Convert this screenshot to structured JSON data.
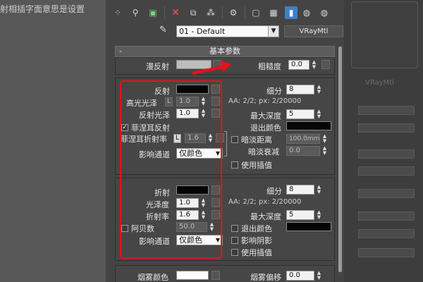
{
  "background": {
    "left_text": "射相插字面意思是设置",
    "right_label": "VRayMtl"
  },
  "toolbar": {
    "icons": [
      "sphere-dots-icon",
      "teapot-icon",
      "green-cube-icon",
      "delete-x-icon",
      "copy-icon",
      "cubes-icon",
      "gears-icon",
      "square-icon",
      "checker-icon",
      "active-slot-icon",
      "globe-icon",
      "globe-2-icon"
    ]
  },
  "material": {
    "name": "01 - Default",
    "type": "VRayMtl"
  },
  "rollout": {
    "title": "基本参数",
    "minus": "-"
  },
  "diffuse": {
    "label": "漫反射",
    "roughness_label": "粗糙度",
    "roughness_value": "0.0"
  },
  "reflection": {
    "reflect_label": "反射",
    "hilight_label": "高光光泽",
    "hilight_lock": "L",
    "hilight_value": "1.0",
    "gloss_label": "反射光泽",
    "gloss_value": "1.0",
    "fresnel_label": "菲涅耳反射",
    "fresnel_ior_label": "菲涅耳折射率",
    "fresnel_ior_lock": "L",
    "fresnel_ior_value": "1.6",
    "affect_label": "影响通道",
    "affect_value": "仅颜色",
    "subdivs_label": "细分",
    "subdivs_value": "8",
    "aa_text": "AA: 2/2; px: 2/20000",
    "max_depth_label": "最大深度",
    "max_depth_value": "5",
    "exit_color_label": "退出颜色",
    "dim_dist_label": "暗淡距离",
    "dim_dist_value": "100.0mm",
    "dim_falloff_label": "暗淡衰减",
    "dim_falloff_value": "0.0",
    "interp_label": "使用插值"
  },
  "refraction": {
    "refract_label": "折射",
    "gloss_label": "光泽度",
    "gloss_value": "1.0",
    "ior_label": "折射率",
    "ior_value": "1.6",
    "abbe_label": "阿贝数",
    "abbe_value": "50.0",
    "affect_label": "影响通道",
    "affect_value": "仅颜色",
    "subdivs_label": "细分",
    "subdivs_value": "8",
    "aa_text": "AA: 2/2; px: 2/20000",
    "max_depth_label": "最大深度",
    "max_depth_value": "5",
    "exit_color_label": "退出颜色",
    "shadows_label": "影响阴影",
    "interp_label": "使用插值"
  },
  "fog": {
    "color_label": "烟雾颜色",
    "bias_label": "烟雾偏移",
    "bias_value": "0.0"
  },
  "colors": {
    "highlight_box": "#e8101b",
    "diffuse_swatch": "#bdbdbd",
    "reflect_swatch": "#050505",
    "fog_swatch": "#ffffff"
  }
}
